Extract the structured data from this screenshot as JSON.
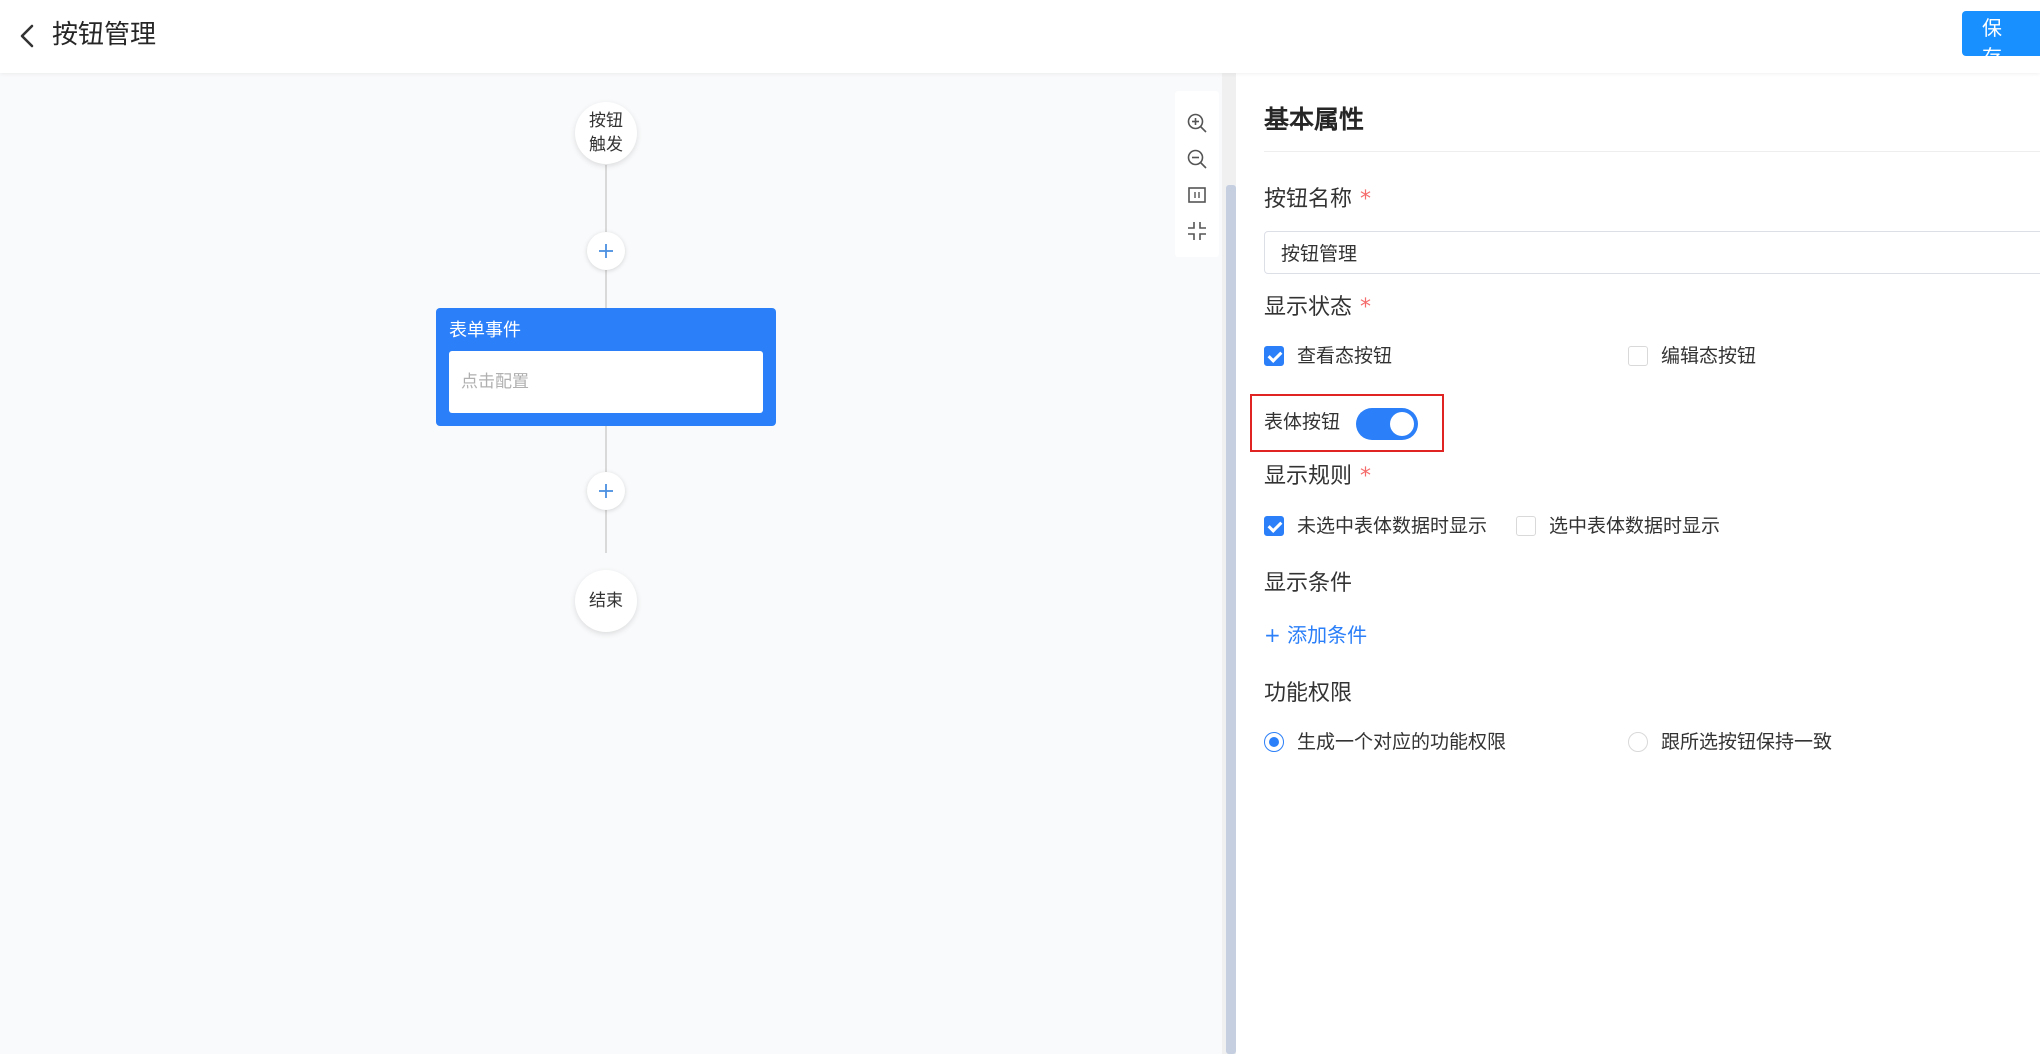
{
  "header": {
    "title": "按钮管理",
    "save_label": "保 存"
  },
  "flow": {
    "start_node": [
      "按钮",
      "触发"
    ],
    "event_card": {
      "title": "表单事件",
      "placeholder": "点击配置"
    },
    "end_node": "结束",
    "zoom_tools": [
      "zoom-in-icon",
      "zoom-out-icon",
      "fit-view-icon",
      "fullscreen-exit-icon"
    ]
  },
  "panel": {
    "title": "基本属性",
    "name_label": "按钮名称",
    "required_mark": "*",
    "name_value": "按钮管理",
    "status_label": "显示状态",
    "status_options": [
      {
        "label": "查看态按钮",
        "checked": true
      },
      {
        "label": "编辑态按钮",
        "checked": false
      }
    ],
    "body_button": {
      "label": "表体按钮",
      "enabled": true
    },
    "rule_label": "显示规则",
    "rule_options": [
      {
        "label": "未选中表体数据时显示",
        "checked": true
      },
      {
        "label": "选中表体数据时显示",
        "checked": false
      }
    ],
    "condition_label": "显示条件",
    "add_condition": "+ 添加条件",
    "permission_label": "功能权限",
    "permission_options": [
      {
        "label": "生成一个对应的功能权限",
        "selected": true
      },
      {
        "label": "跟所选按钮保持一致",
        "selected": false
      }
    ]
  },
  "colors": {
    "primary": "#2b7ff8",
    "save": "#1890ff",
    "required": "#f56c6c",
    "highlight": "#e02424"
  }
}
